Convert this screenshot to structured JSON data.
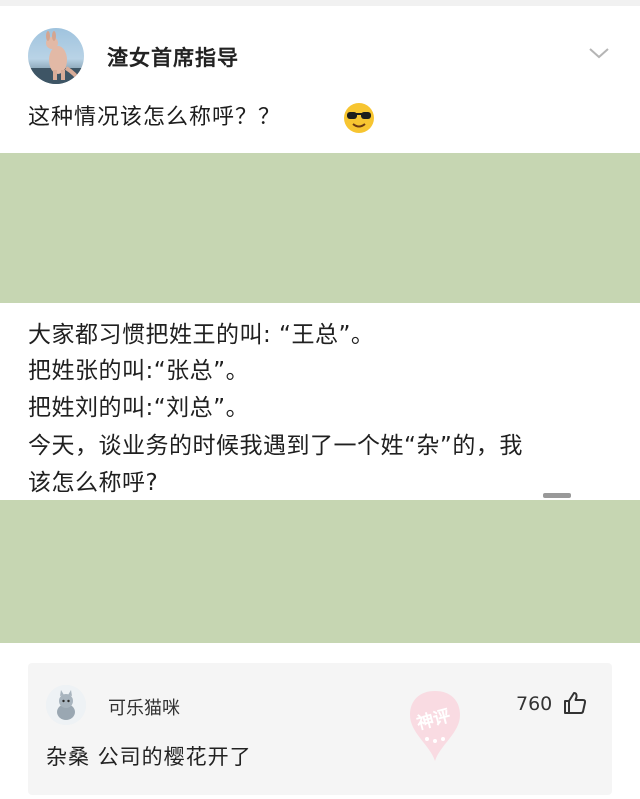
{
  "post": {
    "username": "渣女首席指导",
    "text": "这种情况该怎么称呼？？",
    "emoji": "sunglasses-emoji"
  },
  "meme": {
    "lines": [
      "大家都习惯把姓王的叫: “王总”。",
      "把姓张的叫:“张总”。",
      "把姓刘的叫:“刘总”。",
      "今天，谈业务的时候我遇到了一个姓“杂”的，我",
      "该怎么称呼?"
    ]
  },
  "comment": {
    "username": "可乐猫咪",
    "likes": "760",
    "text": "杂桑 公司的樱花开了",
    "badge": "神评"
  },
  "colors": {
    "green_band": "#c6d6b2",
    "comment_bg": "#f5f5f5",
    "badge_pink": "#f07a96"
  }
}
